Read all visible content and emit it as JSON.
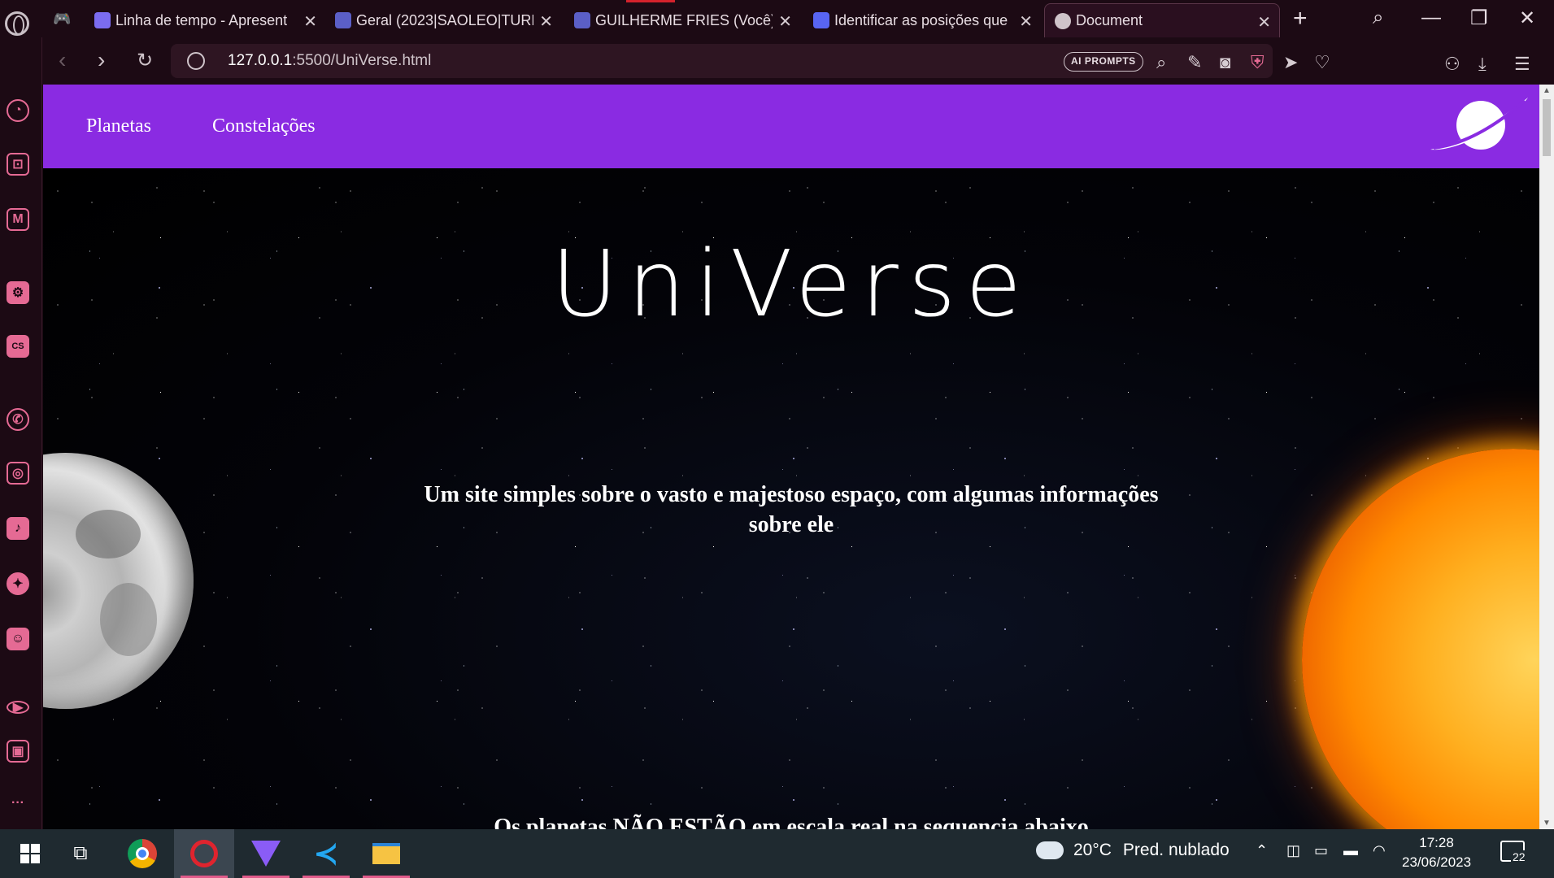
{
  "browser": {
    "tabs": [
      {
        "label": "Linha de tempo - Apresent",
        "favicon_color": "#7b6cf0"
      },
      {
        "label": "Geral (2023|SAOLEO|TURM",
        "favicon_color": "#5b5fc7"
      },
      {
        "label": "GUILHERME FRIES (Você) |",
        "favicon_color": "#5b5fc7"
      },
      {
        "label": "Identificar as posições que",
        "favicon_color": "#5865f2"
      },
      {
        "label": "Document",
        "favicon_color": "#cfc4ca"
      }
    ],
    "url_host": "127.0.0.1",
    "url_rest": ":5500/UniVerse.html",
    "ai_prompts_label": "AI PROMPTS",
    "accent": "#d4222c"
  },
  "sidebar": {
    "items": [
      "speed-dial",
      "store",
      "crypto-wallet",
      "chatgpt",
      "chatsonic",
      "whatsapp",
      "instagram",
      "tiktok",
      "twitter",
      "discord",
      "player",
      "gallery",
      "more"
    ],
    "more_label": "···"
  },
  "site": {
    "nav": {
      "planetas": "Planetas",
      "constelacoes": "Constelações"
    },
    "nav_color": "#8a2be2",
    "title": "UniVerse",
    "subtitle": "Um site simples sobre o vasto e majestoso espaço, com algumas informações sobre ele",
    "next_heading_partial": "Os planetas NÃO ESTÃO em escala real na sequencia abaixo"
  },
  "taskbar": {
    "weather_temp": "20°C",
    "weather_desc": "Pred. nublado",
    "time": "17:28",
    "date": "23/06/2023",
    "notifications": "22"
  }
}
